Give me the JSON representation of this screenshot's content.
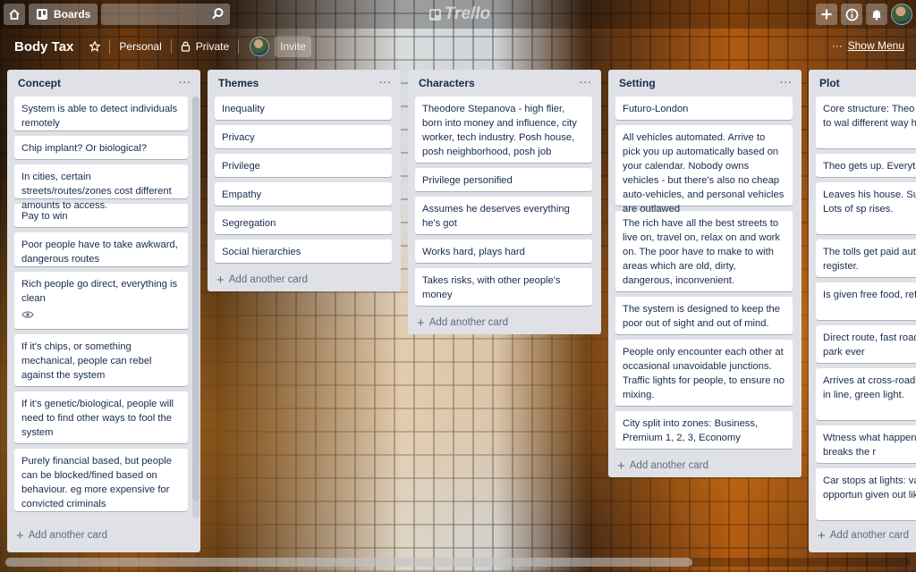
{
  "app": {
    "boards_label": "Boards",
    "logo_text": "Trello"
  },
  "board": {
    "title": "Body Tax",
    "visibility_team": "Personal",
    "visibility_privacy": "Private",
    "invite_label": "Invite",
    "show_menu_label": "Show Menu"
  },
  "lists": [
    {
      "title": "Concept",
      "add_label": "Add another card",
      "cards": [
        "System is able to detect individuals remotely",
        "Chip implant? Or biological?",
        "In cities, certain streets/routes/zones cost different amounts to access.",
        "Pay to win",
        "Poor people have to take awkward, dangerous routes",
        "Rich people go direct, everything is clean",
        "If it's chips, or something mechanical, people can rebel against the system",
        "If it's genetic/biological, people will need to find other ways to fool the system",
        "Purely financial based, but people can be blocked/fined based on behaviour. eg more expensive for convicted criminals"
      ]
    },
    {
      "title": "Themes",
      "add_label": "Add another card",
      "cards": [
        "Inequality",
        "Privacy",
        "Privilege",
        "Empathy",
        "Segregation",
        "Social hierarchies"
      ]
    },
    {
      "title": "Characters",
      "add_label": "Add another card",
      "cards": [
        "Theodore Stepanova - high flier, born into money and influence, city worker, tech industry. Posh house, posh neighborhood, posh job",
        "Privilege personified",
        "Assumes he deserves everything he's got",
        "Works hard, plays hard",
        "Takes risks, with other people's money"
      ]
    },
    {
      "title": "Setting",
      "add_label": "Add another card",
      "cards": [
        "Futuro-London",
        "All vehicles automated. Arrive to pick you up automatically based on your calendar. Nobody owns vehicles - but there's also no cheap auto-vehicles, and personal vehicles are outlawed",
        "The rich have all the best streets to live on, travel on, relax on and work on. The poor have to make to with areas which are old, dirty, dangerous, inconvenient.",
        "The system is designed to keep the poor out of sight and out of mind.",
        "People only encounter each other at occasional unavoidable junctions. Traffic lights for people, to ensure no mixing.",
        "City split into zones: Business, Premium 1, 2, 3, Economy"
      ]
    },
    {
      "title": "Plot",
      "add_label": "Add another card",
      "cards": [
        "Core structure: Theo Gets fired. Has to wal different way home.",
        "Theo gets up. Everyth",
        "Leaves his house. Su neighbours. Lots of sp rises.",
        "The tolls get paid auto doesn't even register.",
        "Is given free food, ref in vehicle.",
        "Direct route, fast road through the park ever",
        "Arrives at cross-roads Poor standing in line, green light.",
        "Wtness what happens someone breaks the r",
        "Car stops at lights: va sponsorship opportun given out like drive thr"
      ]
    }
  ]
}
